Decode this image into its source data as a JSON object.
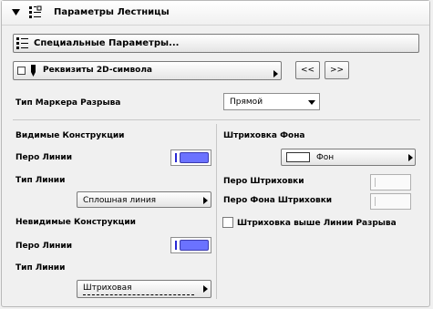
{
  "header": {
    "title": "Параметры Лестницы"
  },
  "special_params_button": "Специальные Параметры...",
  "symbol_2d": {
    "label": "Реквизиты 2D-символа",
    "prev": "<<",
    "next": ">>"
  },
  "break_marker": {
    "label": "Тип Маркера Разрыва",
    "value": "Прямой"
  },
  "visible": {
    "heading": "Видимые Конструкции",
    "pen_label": "Перо Линии",
    "line_type_label": "Тип Линии",
    "line_type_value": "Сплошная линия"
  },
  "hidden": {
    "heading": "Невидимые Конструкции",
    "pen_label": "Перо Линии",
    "line_type_label": "Тип Линии",
    "line_type_value": "Штриховая"
  },
  "fill": {
    "heading": "Штриховка Фона",
    "fill_value": "Фон",
    "hatch_pen_label": "Перо Штриховки",
    "bg_pen_label": "Перо Фона Штриховки",
    "above_break_label": "Штриховка выше Линии Разрыва"
  },
  "colors": {
    "pen_swatch": "#6b72ff"
  }
}
